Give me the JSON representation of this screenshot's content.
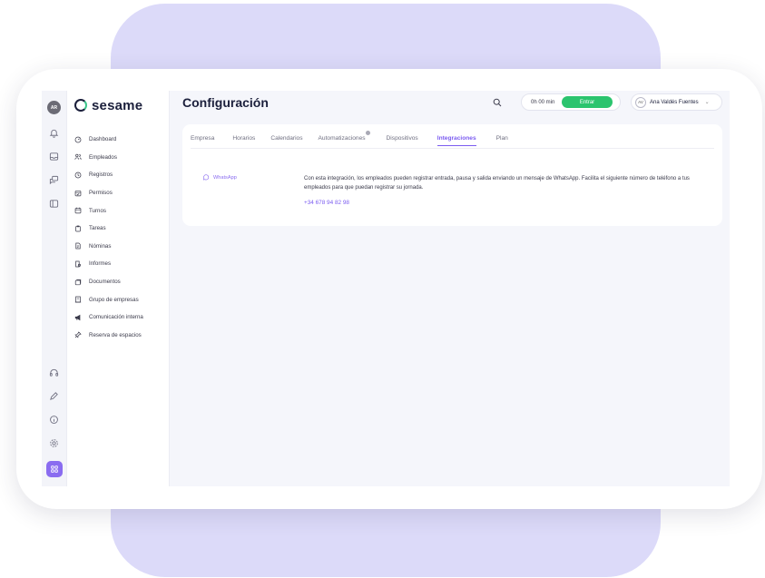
{
  "user": {
    "initials": "AR",
    "name": "Ana Valdés Fuentes",
    "avatar_initials": "AV"
  },
  "brand": {
    "name": "sesame"
  },
  "page": {
    "title": "Configuración"
  },
  "clock": {
    "time": "0h 00 min",
    "action": "Entrar"
  },
  "nav": {
    "items": [
      {
        "label": "Dashboard",
        "icon": "dashboard-icon"
      },
      {
        "label": "Empleados",
        "icon": "users-icon"
      },
      {
        "label": "Registros",
        "icon": "clock-icon"
      },
      {
        "label": "Permisos",
        "icon": "calendar-check-icon"
      },
      {
        "label": "Turnos",
        "icon": "calendar-icon"
      },
      {
        "label": "Tareas",
        "icon": "clipboard-icon"
      },
      {
        "label": "Nóminas",
        "icon": "document-icon"
      },
      {
        "label": "Informes",
        "icon": "report-icon"
      },
      {
        "label": "Documentos",
        "icon": "folder-icon"
      },
      {
        "label": "Grupo de empresas",
        "icon": "building-icon"
      },
      {
        "label": "Comunicación interna",
        "icon": "megaphone-icon"
      },
      {
        "label": "Reserva de espacios",
        "icon": "pin-icon"
      }
    ]
  },
  "tabs": [
    {
      "label": "Empresa"
    },
    {
      "label": "Horarios"
    },
    {
      "label": "Calendarios"
    },
    {
      "label": "Automatizaciones"
    },
    {
      "label": "Dispositivos"
    },
    {
      "label": "Integraciones"
    },
    {
      "label": "Plan"
    }
  ],
  "integration": {
    "name": "WhatsApp",
    "description": "Con esta integración, los empleados pueden registrar entrada, pausa y salida enviando un mensaje de WhatsApp. Facilita el siguiente número de teléfono a tus empleados para que puedan registrar su jornada.",
    "phone": "+34 678 94 82 98"
  },
  "colors": {
    "accent": "#7b5cf0",
    "success": "#2bc46e",
    "decor": "#dcdaf9"
  }
}
